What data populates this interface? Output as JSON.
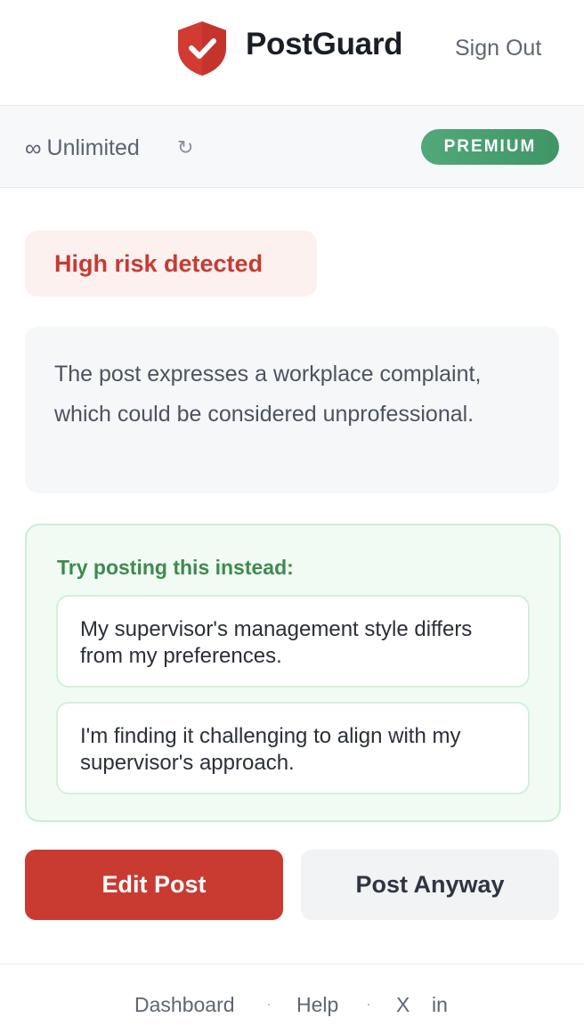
{
  "header": {
    "brand": "PostGuard",
    "sign_out": "Sign Out",
    "logo_icon": "shield-check-icon",
    "brand_color": "#d23b32"
  },
  "status": {
    "infinity_symbol": "∞",
    "plan_label": "Unlimited",
    "refresh_symbol": "↻",
    "badge": "PREMIUM",
    "badge_color": "#4a9e6f"
  },
  "result": {
    "risk_label": "High risk detected",
    "risk_color": "#c93a31",
    "explanation": "The post expresses a workplace complaint, which could be considered unprofessional."
  },
  "suggestions": {
    "title": "Try posting this instead:",
    "items": [
      "My supervisor's management style differs from my preferences.",
      "I'm finding it challenging to align with my supervisor's approach."
    ]
  },
  "actions": {
    "edit": "Edit Post",
    "post_anyway": "Post Anyway"
  },
  "footer": {
    "dashboard": "Dashboard",
    "help": "Help",
    "x": "X",
    "linkedin": "in",
    "separator": "·"
  }
}
